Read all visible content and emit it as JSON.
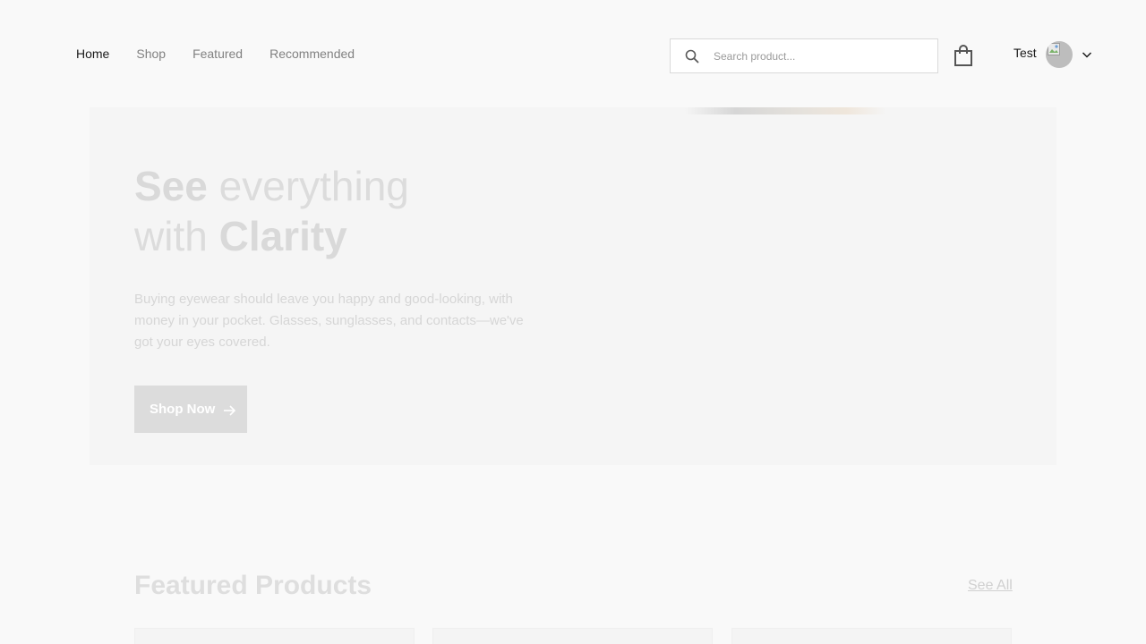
{
  "navbar": {
    "links": [
      {
        "label": "Home",
        "active": true
      },
      {
        "label": "Shop",
        "active": false
      },
      {
        "label": "Featured",
        "active": false
      },
      {
        "label": "Recommended",
        "active": false
      }
    ],
    "search": {
      "placeholder": "Search product...",
      "value": "",
      "icon": "search-icon"
    },
    "cart_icon": "shopping-bag-icon",
    "user": {
      "name": "Test",
      "dropdown_icon": "chevron-down-icon"
    }
  },
  "banner": {
    "title_line1_bold": "See",
    "title_line1_rest": " everything",
    "title_line2_rest": "with ",
    "title_line2_bold": "Clarity",
    "description": "Buying eyewear should leave you happy and good-looking, with money in your pocket. Glasses, sunglasses, and contacts—we've got your eyes covered.",
    "cta_label": "Shop Now",
    "cta_icon": "arrow-right-icon"
  },
  "featured": {
    "title": "Featured Products",
    "see_all_label": "See All"
  },
  "colors": {
    "active_nav": "#1a1a1a",
    "inactive_nav": "#818181",
    "page_background": "#f9f9f9",
    "button_background": "#dcdcdc"
  }
}
